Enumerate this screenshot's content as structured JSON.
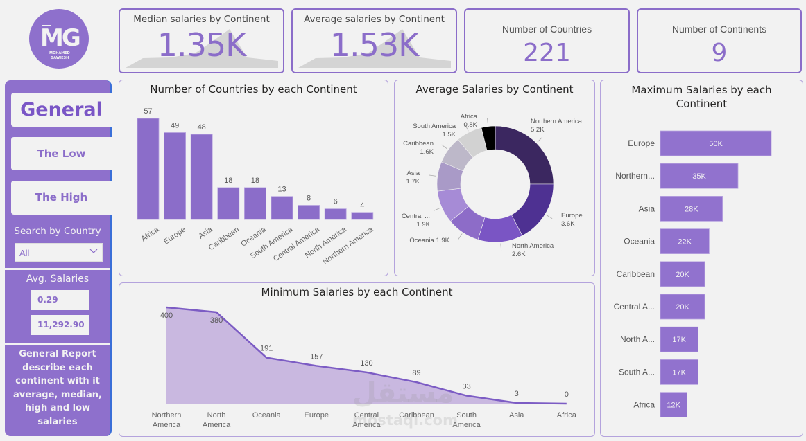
{
  "logo": {
    "initials": "MG",
    "line1": "MOHAMED",
    "line2": "GAWIESH"
  },
  "kpis": [
    {
      "title": "Median salaries by Continent",
      "value": "1.35K"
    },
    {
      "title": "Average salaries by Continent",
      "value": "1.53K"
    },
    {
      "title": "Number of Countries",
      "value": "221"
    },
    {
      "title": "Number of Continents",
      "value": "9"
    }
  ],
  "sidebar": {
    "nav": [
      {
        "label": "General",
        "active": true
      },
      {
        "label": "The Low",
        "active": false
      },
      {
        "label": "The High",
        "active": false
      }
    ],
    "search_label": "Search by Country",
    "search_value": "All",
    "avg_label": "Avg. Salaries",
    "avg_min": "0.29",
    "avg_max": "11,292.90",
    "description": "General Report describe each continent with it average, median, high and low salaries"
  },
  "colors": {
    "accent": "#8b6dc9",
    "sidebar": "#8e70cc",
    "background": "#f2f2f2",
    "area_fill": "#c9b8e0",
    "line": "#7c5cc4"
  },
  "watermark": {
    "arabic": "مستقل",
    "latin": "mostaql.com"
  },
  "chart_data": [
    {
      "id": "countries-by-continent",
      "type": "bar",
      "title": "Number of Countries by each Continent",
      "categories": [
        "Africa",
        "Europe",
        "Asia",
        "Caribbean",
        "Oceania",
        "South America",
        "Central America",
        "North America",
        "Northern America"
      ],
      "values": [
        57,
        49,
        48,
        18,
        18,
        13,
        8,
        6,
        4
      ],
      "xlabel": "",
      "ylabel": "",
      "ylim": [
        0,
        57
      ],
      "grid": false
    },
    {
      "id": "avg-salaries-by-continent",
      "type": "pie",
      "subtype": "donut",
      "title": "Average Salaries by Continent",
      "slices": [
        {
          "label": "Northern America",
          "display": "5.2K",
          "value": 5200,
          "color": "#3b2760"
        },
        {
          "label": "Europe",
          "display": "3.6K",
          "value": 3600,
          "color": "#4e3192"
        },
        {
          "label": "North America",
          "display": "2.6K",
          "value": 2600,
          "color": "#7a55c4"
        },
        {
          "label": "Oceania",
          "display": "1.9K",
          "value": 1900,
          "color": "#8d6cc8"
        },
        {
          "label": "Central ...",
          "display": "1.9K",
          "value": 1900,
          "color": "#a68bd6"
        },
        {
          "label": "Asia",
          "display": "1.7K",
          "value": 1700,
          "color": "#a99ac7"
        },
        {
          "label": "Caribbean",
          "display": "1.6K",
          "value": 1600,
          "color": "#bdb8c9"
        },
        {
          "label": "South America",
          "display": "1.5K",
          "value": 1500,
          "color": "#d2d2d2"
        },
        {
          "label": "Africa",
          "display": "0.8K",
          "value": 800,
          "color": "#000000"
        }
      ],
      "legend": "none"
    },
    {
      "id": "max-salaries-by-continent",
      "type": "bar",
      "orientation": "horizontal",
      "title": "Maximum Salaries by each Continent",
      "categories": [
        "Europe",
        "Northern...",
        "Asia",
        "Oceania",
        "Caribbean",
        "Central A...",
        "North A...",
        "South A...",
        "Africa"
      ],
      "values": [
        50000,
        35000,
        28000,
        22000,
        20000,
        20000,
        17000,
        17000,
        12000
      ],
      "labels": [
        "50K",
        "35K",
        "28K",
        "22K",
        "20K",
        "20K",
        "17K",
        "17K",
        "12K"
      ],
      "xlim": [
        0,
        50000
      ],
      "grid": false
    },
    {
      "id": "min-salaries-by-continent",
      "type": "area",
      "title": "Minimum Salaries by each Continent",
      "categories": [
        "Northern America",
        "North America",
        "Oceania",
        "Europe",
        "Central America",
        "Caribbean",
        "South America",
        "Asia",
        "Africa"
      ],
      "values": [
        400,
        380,
        191,
        157,
        130,
        89,
        33,
        3,
        0
      ],
      "ylim": [
        0,
        400
      ],
      "grid": false
    }
  ]
}
